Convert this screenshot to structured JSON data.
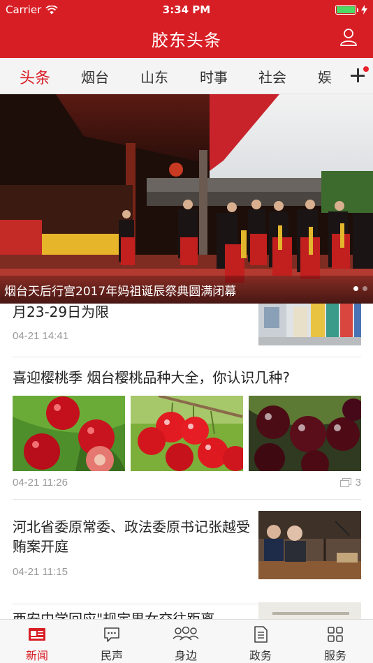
{
  "status_bar": {
    "carrier": "Carrier",
    "time": "3:34 PM"
  },
  "header": {
    "title": "胶东头条"
  },
  "tabs": [
    {
      "label": "头条",
      "active": true
    },
    {
      "label": "烟台"
    },
    {
      "label": "山东"
    },
    {
      "label": "时事"
    },
    {
      "label": "社会"
    },
    {
      "label": "娱"
    }
  ],
  "banner": {
    "caption": "烟台天后行宫2017年妈祖诞辰祭典圆满闭幕",
    "page_count": 2,
    "active_page": 1
  },
  "feed": [
    {
      "title": "月23-29日为限",
      "time": "04-21 14:41"
    },
    {
      "title": "喜迎樱桃季 烟台樱桃品种大全，你认识几种?",
      "time": "04-21 11:26",
      "image_count": "3"
    },
    {
      "title": "河北省委原常委、政法委原书记张越受贿案开庭",
      "time": "04-21 11:15"
    },
    {
      "title": "西安中学回应\"规定男女交往距离"
    }
  ],
  "bottom_nav": [
    {
      "label": "新闻",
      "icon": "newspaper-icon",
      "active": true
    },
    {
      "label": "民声",
      "icon": "chat-bubble-icon"
    },
    {
      "label": "身边",
      "icon": "people-icon"
    },
    {
      "label": "政务",
      "icon": "document-icon"
    },
    {
      "label": "服务",
      "icon": "grid-icon"
    }
  ],
  "colors": {
    "brand_red": "#d81e25",
    "muted_text": "#999999",
    "battery_green": "#4cd964"
  }
}
